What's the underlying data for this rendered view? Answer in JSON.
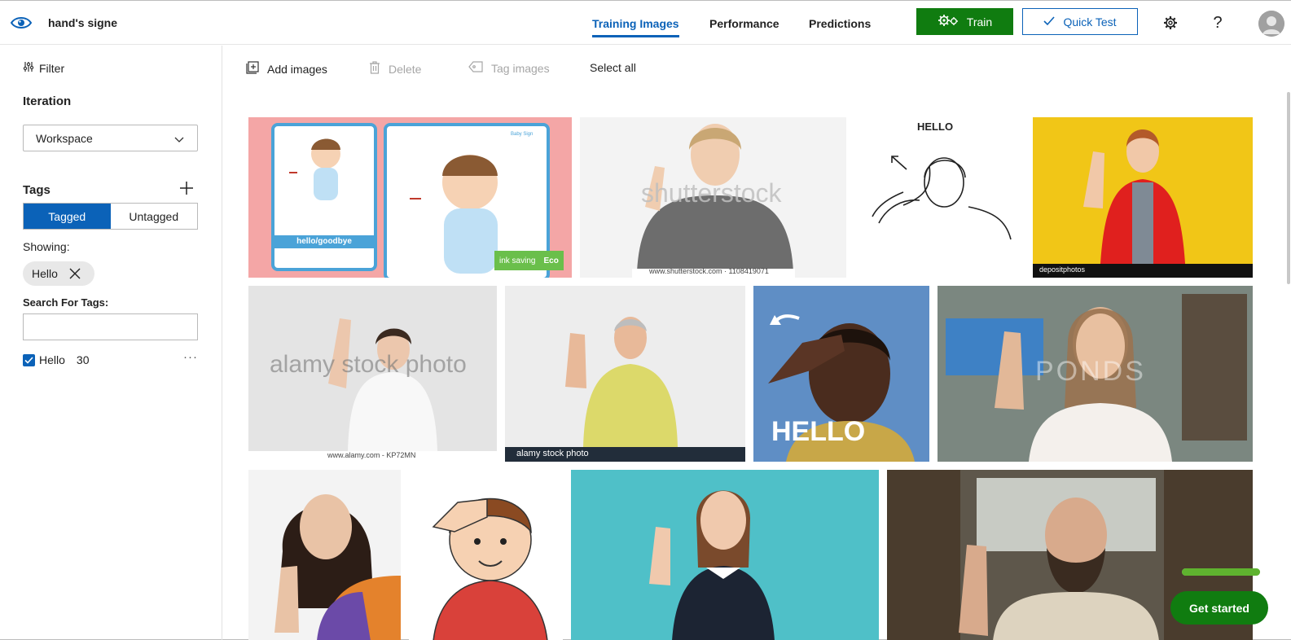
{
  "header": {
    "project_name": "hand's signe",
    "tabs": [
      {
        "label": "Training Images",
        "active": true
      },
      {
        "label": "Performance",
        "active": false
      },
      {
        "label": "Predictions",
        "active": false
      }
    ],
    "train_label": "Train",
    "quick_test_label": "Quick Test",
    "icons": [
      "eye-logo-icon",
      "gear-icon",
      "help-icon",
      "avatar"
    ]
  },
  "sidebar": {
    "filter_label": "Filter",
    "iteration_heading": "Iteration",
    "iteration_value": "Workspace",
    "tags_heading": "Tags",
    "segments": {
      "tagged": "Tagged",
      "untagged": "Untagged",
      "selected": "Tagged"
    },
    "showing_label": "Showing:",
    "showing_chip": "Hello",
    "search_label": "Search For Tags:",
    "search_value": "",
    "tags": [
      {
        "name": "Hello",
        "count": "30",
        "checked": true
      }
    ]
  },
  "toolbar": {
    "add_images": "Add images",
    "delete": "Delete",
    "tag_images": "Tag images",
    "select_all": "Select all"
  },
  "gallery": {
    "images": [
      {
        "caption": "hello/goodbye",
        "badge_text": "ink saving",
        "badge_tag": "Eco",
        "header": "Baby Sign"
      },
      {
        "watermark": "shutterstock",
        "footer": "www.shutterstock.com · 1108419071"
      },
      {
        "caption": "HELLO"
      },
      {
        "watermark": "depositphotos"
      },
      {
        "watermark": "alamy stock photo",
        "footer": "www.alamy.com - KP72MN"
      },
      {
        "watermark": "alamy stock photo"
      },
      {
        "caption": "HELLO"
      },
      {
        "watermark": "PONDS"
      },
      {},
      {},
      {},
      {}
    ]
  },
  "get_started_label": "Get started",
  "colors": {
    "accent": "#0b62b8",
    "train_green": "#107c10",
    "progress_green": "#5fb32f"
  }
}
